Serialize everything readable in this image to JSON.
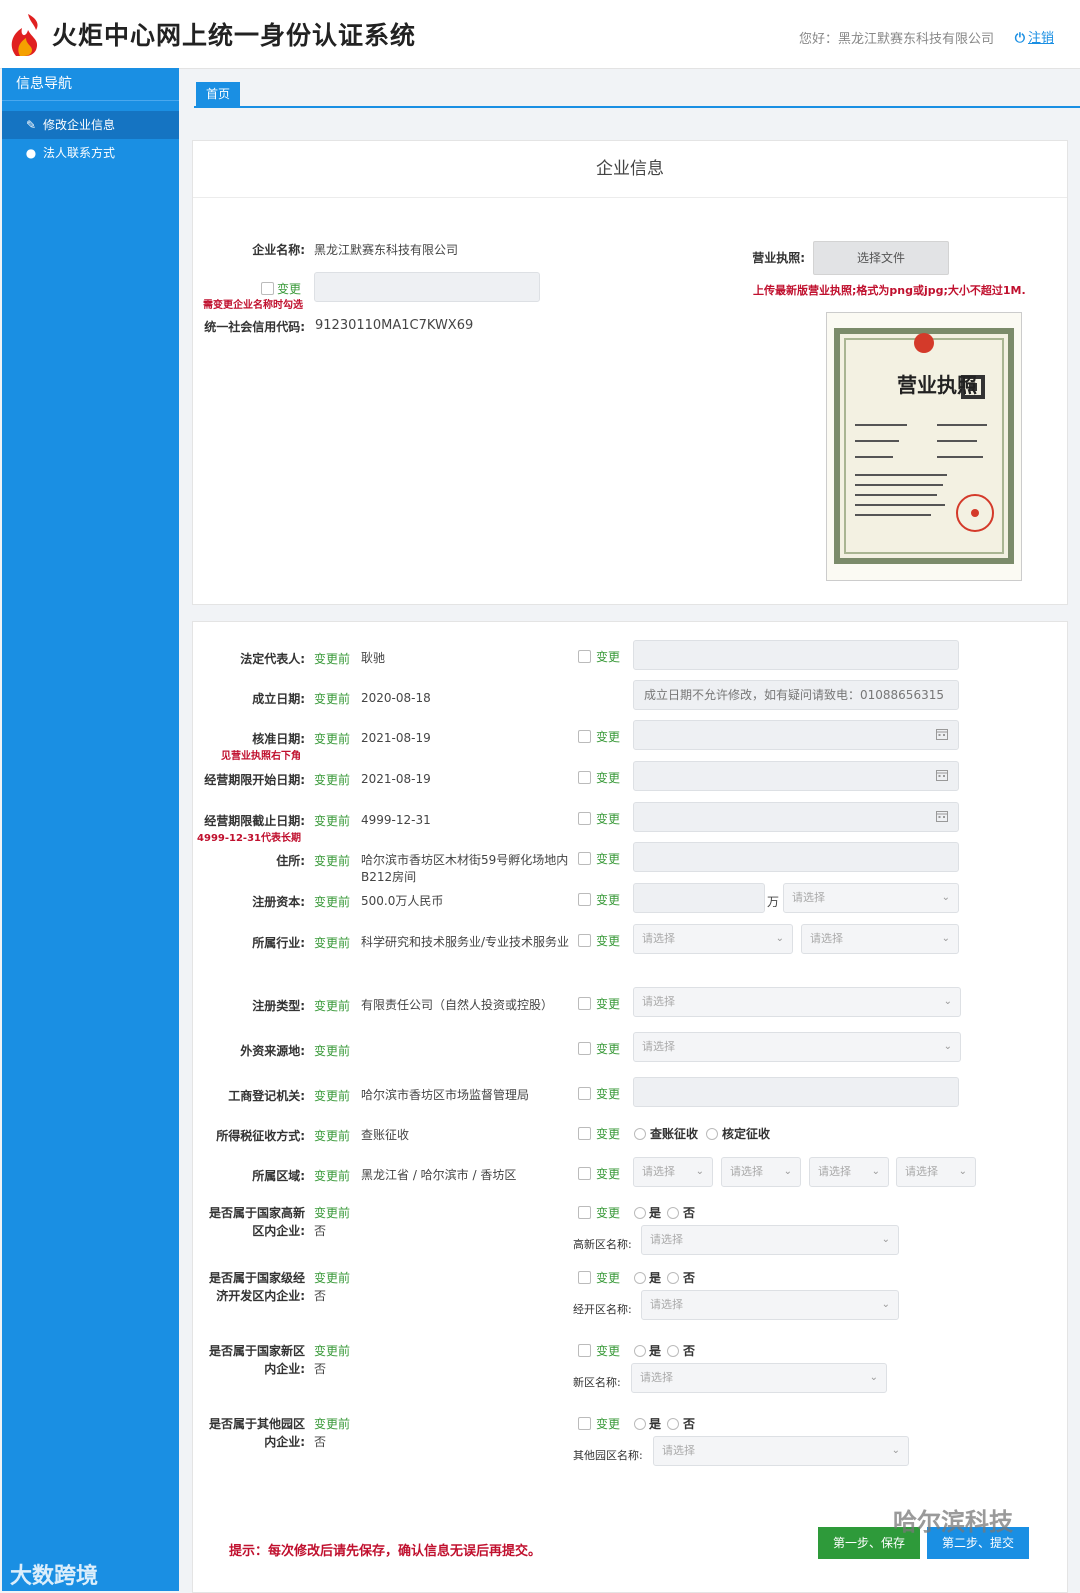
{
  "header": {
    "title": "火炬中心网上统一身份认证系统",
    "greeting": "您好：黑龙江默赛东科技有限公司",
    "logout": "注销"
  },
  "sidebar": {
    "title": "信息导航",
    "items": [
      {
        "label": "修改企业信息",
        "icon": "edit-icon"
      },
      {
        "label": "法人联系方式",
        "icon": "user-icon"
      }
    ]
  },
  "tabs": [
    {
      "label": "首页"
    }
  ],
  "company_card": {
    "title": "企业信息",
    "name_label": "企业名称:",
    "name_value": "黑龙江默赛东科技有限公司",
    "change_label": "变更",
    "change_hint": "需变更企业名称时勾选",
    "credit_label": "统一社会信用代码:",
    "credit_value": "91230110MA1C7KWX69",
    "license_label": "营业执照:",
    "file_button": "选择文件",
    "license_hint": "上传最新版营业执照;格式为png或jpg;大小不超过1M.",
    "license_image_text": "营业执照"
  },
  "form": {
    "before_label": "变更前",
    "change_label": "变更",
    "placeholder_select": "请选择",
    "rows": [
      {
        "label": "法定代表人:",
        "value": "耿驰"
      },
      {
        "label": "成立日期:",
        "value": "2020-08-18",
        "note": "成立日期不允许修改，如有疑问请致电：01088656315"
      },
      {
        "label": "核准日期:",
        "value": "2021-08-19",
        "hint": "见营业执照右下角"
      },
      {
        "label": "经营期限开始日期:",
        "value": "2021-08-19"
      },
      {
        "label": "经营期限截止日期:",
        "value": "4999-12-31",
        "hint": "4999-12-31代表长期"
      },
      {
        "label": "住所:",
        "value": "哈尔滨市香坊区木材街59号孵化场地内B212房间"
      },
      {
        "label": "注册资本:",
        "value": "500.0万人民币",
        "unit": "万"
      },
      {
        "label": "所属行业:",
        "value": "科学研究和技术服务业/专业技术服务业"
      },
      {
        "label": "注册类型:",
        "value": "有限责任公司（自然人投资或控股）"
      },
      {
        "label": "外资来源地:",
        "value": ""
      },
      {
        "label": "工商登记机关:",
        "value": "哈尔滨市香坊区市场监督管理局"
      },
      {
        "label": "所得税征收方式:",
        "value": "查账征收",
        "options": [
          "查账征收",
          "核定征收"
        ]
      },
      {
        "label": "所属区域:",
        "value": "黑龙江省 / 哈尔滨市 / 香坊区"
      }
    ],
    "yesno": [
      {
        "label1": "是否属于国家高新",
        "label2": "区内企业:",
        "value": "否",
        "sub_label": "高新区名称:"
      },
      {
        "label1": "是否属于国家级经",
        "label2": "济开发区内企业:",
        "value": "否",
        "sub_label": "经开区名称:"
      },
      {
        "label1": "是否属于国家新区",
        "label2": "内企业:",
        "value": "否",
        "sub_label": "新区名称:"
      },
      {
        "label1": "是否属于其他园区",
        "label2": "内企业:",
        "value": "否",
        "sub_label": "其他园区名称:"
      }
    ],
    "yes": "是",
    "no": "否",
    "tip": "提示：每次修改后请先保存，确认信息无误后再提交。",
    "btn_save": "第一步、保存",
    "btn_submit": "第二步、提交"
  },
  "watermarks": {
    "left": "大数跨境",
    "right": "哈尔滨科技"
  },
  "colors": {
    "accent": "#1a8fe3",
    "green": "#3a9a3a",
    "red": "#c0102e"
  }
}
